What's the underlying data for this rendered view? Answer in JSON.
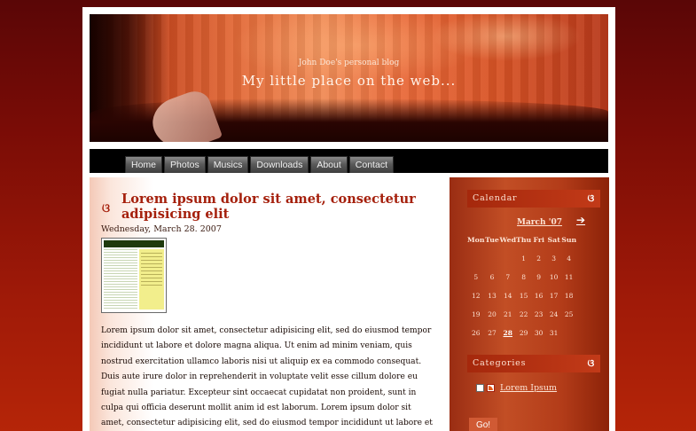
{
  "header": {
    "owner": "John Doe's personal blog",
    "tagline": "My little place on the web..."
  },
  "nav": {
    "items": [
      "Home",
      "Photos",
      "Musics",
      "Downloads",
      "About",
      "Contact"
    ]
  },
  "post": {
    "title": "Lorem ipsum dolor sit amet, consectetur adipisicing elit",
    "date": "Wednesday, March 28. 2007",
    "body": "Lorem ipsum dolor sit amet, consectetur adipisicing elit, sed do eiusmod tempor incididunt ut labore et dolore magna aliqua. Ut enim ad minim veniam, quis nostrud exercitation ullamco laboris nisi ut aliquip ex ea commodo consequat. Duis aute irure dolor in reprehenderit in voluptate velit esse cillum dolore eu fugiat nulla pariatur. Excepteur sint occaecat cupidatat non proident, sunt in culpa qui officia deserunt mollit anim id est laborum. Lorem ipsum dolor sit amet, consectetur adipisicing elit, sed do eiusmod tempor incididunt ut labore et dolore magna aliqua. Ut enim ad minim veniam,"
  },
  "sidebar": {
    "calendar": {
      "heading": "Calendar",
      "month": "March '07",
      "next": "➔",
      "weekdays": [
        "Mon",
        "Tue",
        "Wed",
        "Thu",
        "Fri",
        "Sat",
        "Sun"
      ],
      "weeks": [
        [
          "",
          "",
          "",
          "1",
          "2",
          "3",
          "4"
        ],
        [
          "5",
          "6",
          "7",
          "8",
          "9",
          "10",
          "11"
        ],
        [
          "12",
          "13",
          "14",
          "15",
          "16",
          "17",
          "18"
        ],
        [
          "19",
          "20",
          "21",
          "22",
          "23",
          "24",
          "25"
        ],
        [
          "26",
          "27",
          "28",
          "29",
          "30",
          "31",
          ""
        ]
      ],
      "today": "28"
    },
    "categories": {
      "heading": "Categories",
      "items": [
        "Lorem Ipsum"
      ]
    },
    "go_label": "Go!"
  }
}
